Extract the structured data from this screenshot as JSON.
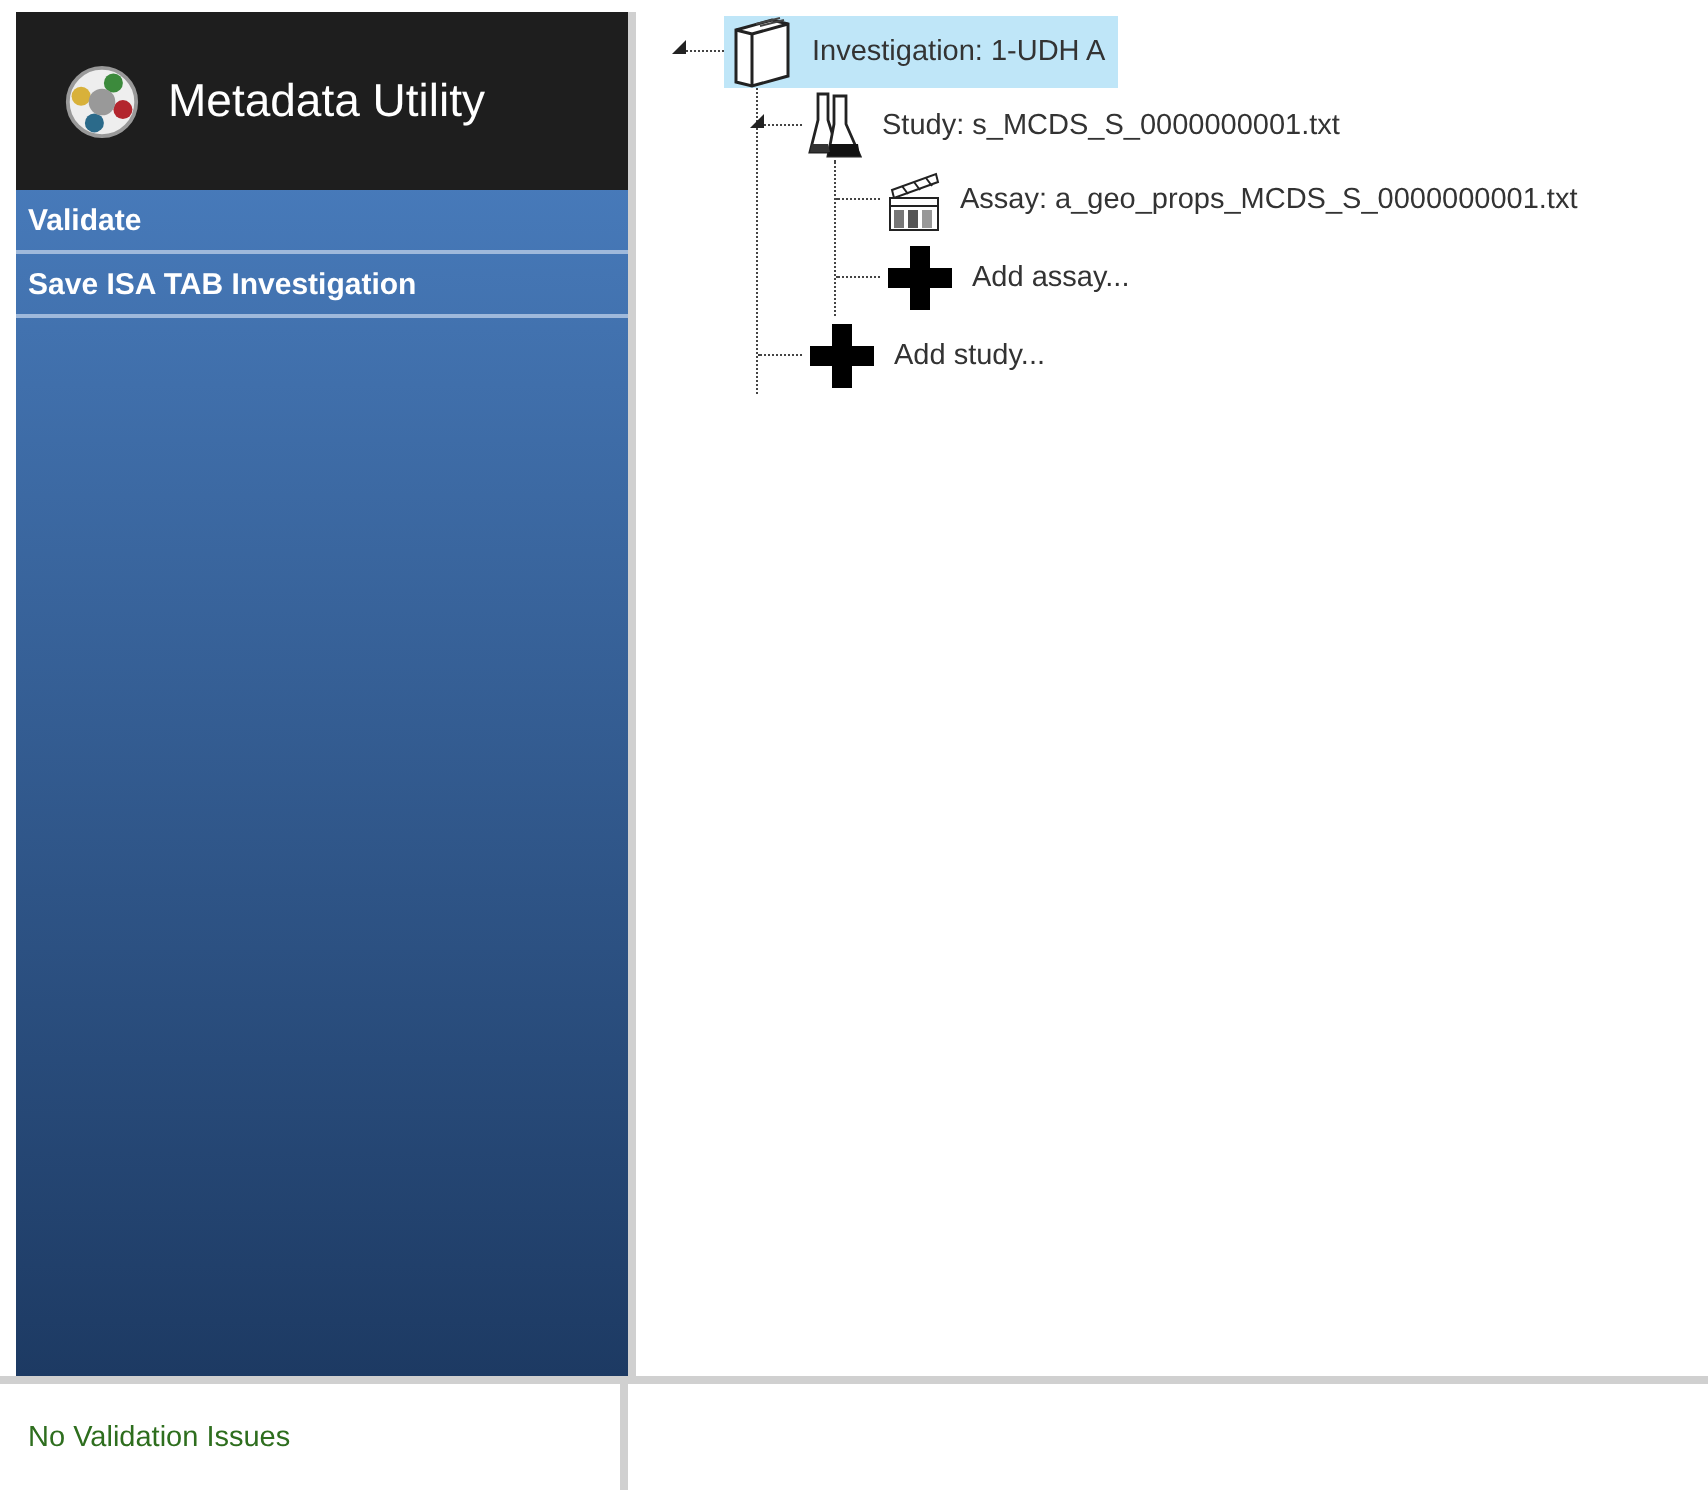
{
  "sidebar": {
    "title": "Metadata Utility",
    "items": [
      {
        "label": "Validate"
      },
      {
        "label": "Save ISA TAB Investigation"
      }
    ]
  },
  "tree": [
    {
      "kind": "investigation",
      "label": "Investigation: 1-UDH A",
      "selected": true,
      "expanded": true,
      "children": [
        {
          "kind": "study",
          "label": "Study: s_MCDS_S_0000000001.txt",
          "selected": false,
          "expanded": true,
          "children": [
            {
              "kind": "assay",
              "label": "Assay: a_geo_props_MCDS_S_0000000001.txt",
              "selected": false
            },
            {
              "kind": "add",
              "label": "Add assay...",
              "selected": false
            }
          ]
        },
        {
          "kind": "add",
          "label": "Add study...",
          "selected": false
        }
      ]
    }
  ],
  "status": "No Validation Issues"
}
